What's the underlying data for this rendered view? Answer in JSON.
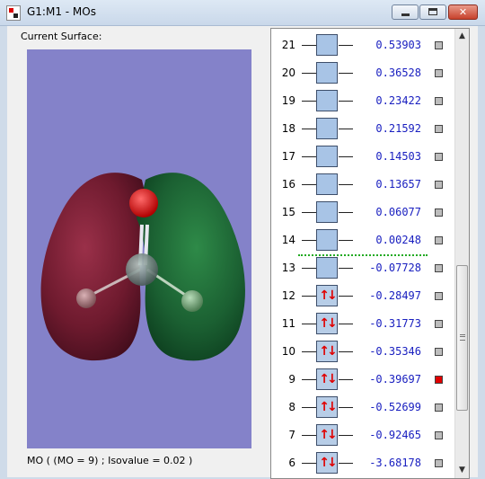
{
  "window": {
    "title": "G1:M1 - MOs",
    "minimize_label": "",
    "maximize_label": "",
    "close_label": "✕"
  },
  "surface_label": "Current Surface:",
  "status_line": "MO ( (MO = 9) ; Isovalue = 0.02 )",
  "orbitals": [
    {
      "num": "21",
      "energy": "0.53903",
      "occupied": false,
      "selected": false
    },
    {
      "num": "20",
      "energy": "0.36528",
      "occupied": false,
      "selected": false
    },
    {
      "num": "19",
      "energy": "0.23422",
      "occupied": false,
      "selected": false
    },
    {
      "num": "18",
      "energy": "0.21592",
      "occupied": false,
      "selected": false
    },
    {
      "num": "17",
      "energy": "0.14503",
      "occupied": false,
      "selected": false
    },
    {
      "num": "16",
      "energy": "0.13657",
      "occupied": false,
      "selected": false
    },
    {
      "num": "15",
      "energy": "0.06077",
      "occupied": false,
      "selected": false
    },
    {
      "num": "14",
      "energy": "0.00248",
      "occupied": false,
      "selected": false
    },
    {
      "num": "13",
      "energy": "-0.07728",
      "occupied": false,
      "selected": false
    },
    {
      "num": "12",
      "energy": "-0.28497",
      "occupied": true,
      "selected": false
    },
    {
      "num": "11",
      "energy": "-0.31773",
      "occupied": true,
      "selected": false
    },
    {
      "num": "10",
      "energy": "-0.35346",
      "occupied": true,
      "selected": false
    },
    {
      "num": "9",
      "energy": "-0.39697",
      "occupied": true,
      "selected": true
    },
    {
      "num": "8",
      "energy": "-0.52699",
      "occupied": true,
      "selected": false
    },
    {
      "num": "7",
      "energy": "-0.92465",
      "occupied": true,
      "selected": false
    },
    {
      "num": "6",
      "energy": "-3.68178",
      "occupied": true,
      "selected": false
    }
  ],
  "colors": {
    "viewer_background": "#8482c9",
    "lobe_negative": "#7a1f33",
    "lobe_positive": "#1f6b35",
    "energy_text": "#1a20c0",
    "electron_arrows": "#e00000",
    "selected_checkbox": "#e00000",
    "homo_lumo_separator": "#22aa22"
  },
  "icons": {
    "app": "gaussview-app-icon",
    "scroll_up": "scroll-up-arrow-icon",
    "scroll_down": "scroll-down-arrow-icon"
  }
}
